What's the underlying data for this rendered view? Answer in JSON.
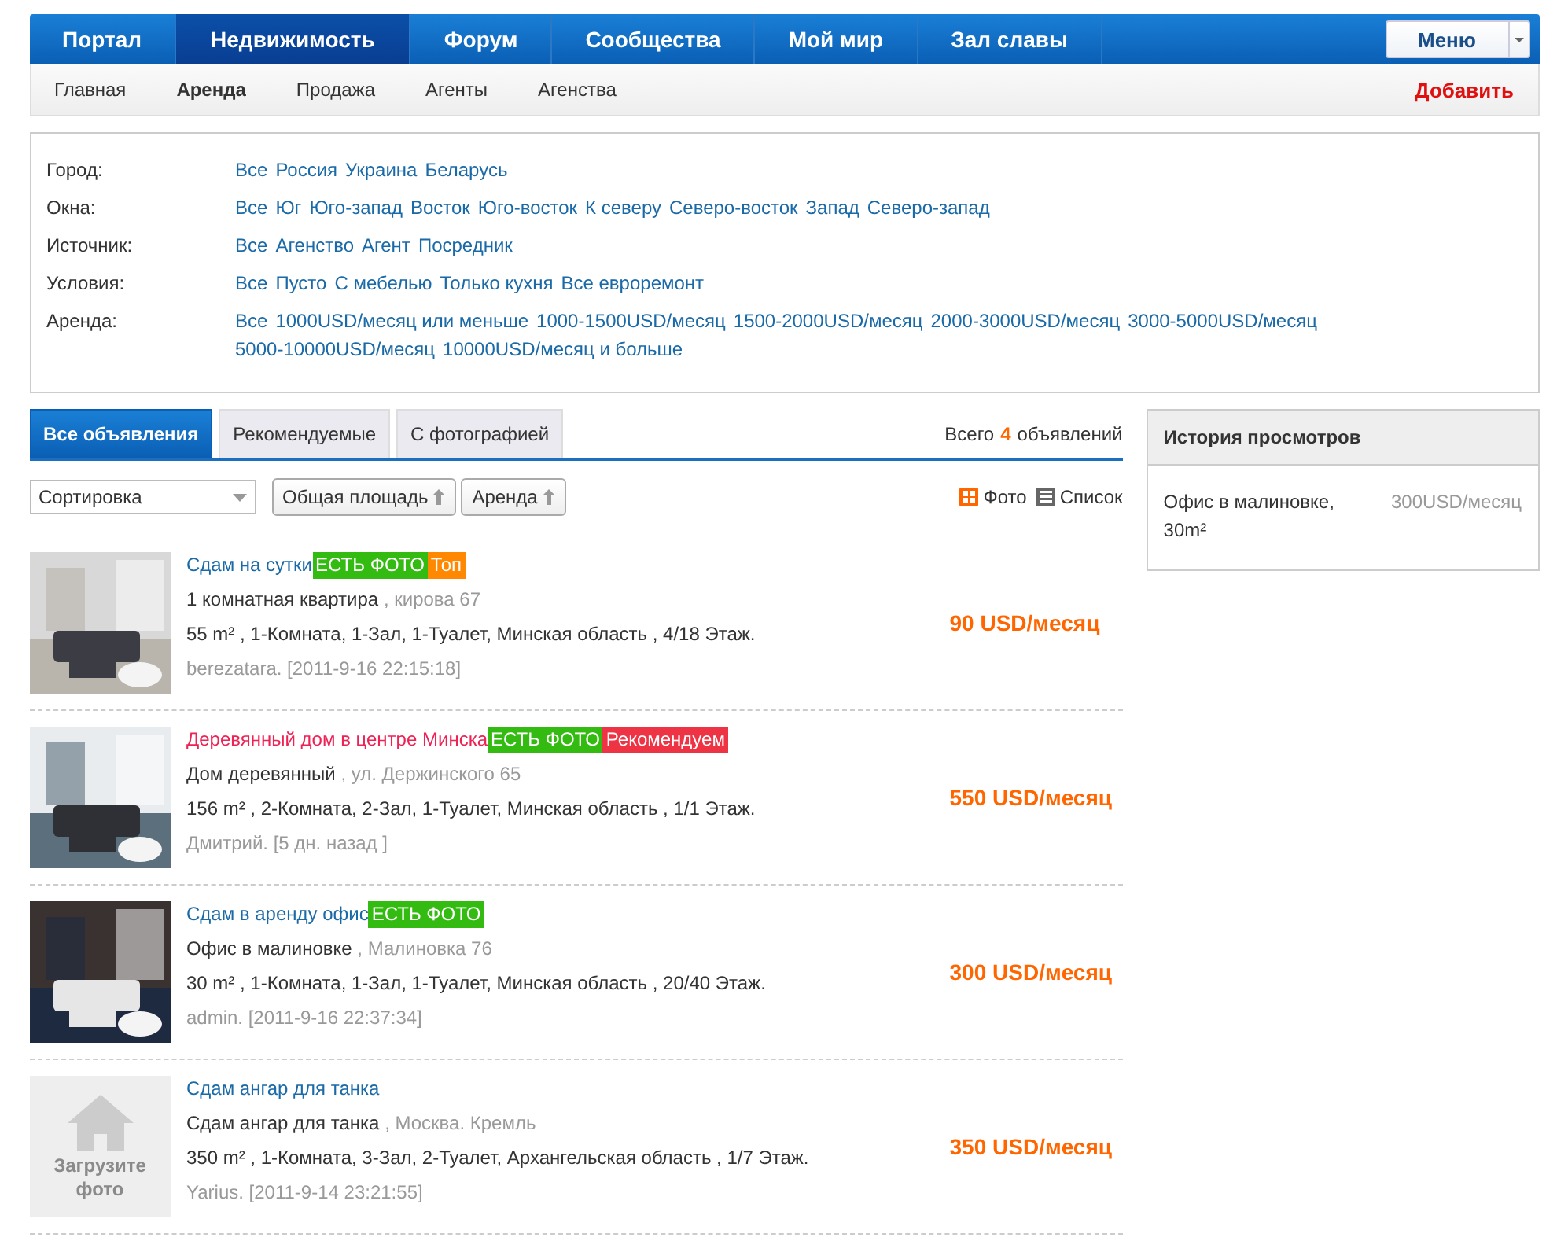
{
  "top_nav": {
    "items": [
      {
        "label": "Портал",
        "selected": false
      },
      {
        "label": "Недвижимость",
        "selected": true
      },
      {
        "label": "Форум",
        "selected": false
      },
      {
        "label": "Сообщества",
        "selected": false
      },
      {
        "label": "Мой мир",
        "selected": false
      },
      {
        "label": "Зал славы",
        "selected": false
      }
    ],
    "menu_button": "Меню"
  },
  "sub_nav": {
    "items": [
      {
        "label": "Главная",
        "selected": false
      },
      {
        "label": "Аренда",
        "selected": true
      },
      {
        "label": "Продажа",
        "selected": false
      },
      {
        "label": "Агенты",
        "selected": false
      },
      {
        "label": "Агенства",
        "selected": false
      }
    ],
    "add_link": "Добавить"
  },
  "filters": [
    {
      "label": "Город:",
      "options": [
        "Все",
        "Россия",
        "Украина",
        "Беларусь"
      ]
    },
    {
      "label": "Окна:",
      "options": [
        "Все",
        "Юг",
        "Юго-запад",
        "Восток",
        "Юго-восток",
        "К северу",
        "Северо-восток",
        "Запад",
        "Северо-запад"
      ]
    },
    {
      "label": "Источник:",
      "options": [
        "Все",
        "Агенство",
        "Агент",
        "Посредник"
      ]
    },
    {
      "label": "Условия:",
      "options": [
        "Все",
        "Пусто",
        "С мебелью",
        "Только кухня",
        "Все евроремонт"
      ]
    },
    {
      "label": "Аренда:",
      "options": [
        "Все",
        "1000USD/месяц или меньше",
        "1000-1500USD/месяц",
        "1500-2000USD/месяц",
        "2000-3000USD/месяц",
        "3000-5000USD/месяц",
        "5000-10000USD/месяц",
        "10000USD/месяц и больше"
      ]
    }
  ],
  "tabs": [
    {
      "label": "Все объявления",
      "selected": true
    },
    {
      "label": "Рекомендуемые",
      "selected": false
    },
    {
      "label": "С фотографией",
      "selected": false
    }
  ],
  "total": {
    "prefix": "Всего",
    "count": "4",
    "suffix": "объявлений"
  },
  "toolbar": {
    "sort_select": "Сортировка",
    "sort_buttons": [
      "Общая площадь",
      "Аренда"
    ],
    "views": [
      {
        "label": "Фото",
        "kind": "grid",
        "selected": true
      },
      {
        "label": "Список",
        "kind": "list",
        "selected": false
      }
    ]
  },
  "listings": [
    {
      "title": "Сдам на сутки",
      "highlighted": false,
      "badges": [
        {
          "label": "ЕСТЬ ФОТО",
          "color": "#33bb11"
        },
        {
          "label": "Топ",
          "color": "#ff8800"
        }
      ],
      "subtitle": "1 комнатная квартира",
      "address": ", кирова 67",
      "details": "55 m² , 1-Комната, 1-Зал, 1-Туалет, Минская область , 4/18 Этаж.",
      "meta": "berezatara. [2011-9-16 22:15:18]",
      "price": "90 USD/месяц",
      "image": {
        "kind": "picture"
      }
    },
    {
      "title": "Деревянный дом в центре Минска",
      "highlighted": true,
      "badges": [
        {
          "label": "ЕСТЬ ФОТО",
          "color": "#33bb11"
        },
        {
          "label": "Рекомендуем",
          "color": "#ee3344"
        }
      ],
      "subtitle": "Дом деревянный",
      "address": ", ул. Держинского 65",
      "details": "156 m² , 2-Комната, 2-Зал, 1-Туалет, Минская область , 1/1 Этаж.",
      "meta": "Дмитрий. [5 дн. назад ]",
      "price": "550 USD/месяц",
      "image": {
        "kind": "picture"
      }
    },
    {
      "title": "Сдам в аренду офис",
      "highlighted": false,
      "badges": [
        {
          "label": "ЕСТЬ ФОТО",
          "color": "#33bb11"
        }
      ],
      "subtitle": "Офис в малиновке",
      "address": ", Малиновка 76",
      "details": "30 m² , 1-Комната, 1-Зал, 1-Туалет, Минская область , 20/40 Этаж.",
      "meta": "admin. [2011-9-16 22:37:34]",
      "price": "300 USD/месяц",
      "image": {
        "kind": "picture"
      }
    },
    {
      "title": "Сдам ангар для танка",
      "highlighted": false,
      "subtitle": "Сдам ангар для танка",
      "address": ", Москва. Кремль",
      "details": "350 m² , 1-Комната, 3-Зал, 2-Туалет, Архангельская область , 1/7 Этаж.",
      "meta": "Yarius. [2011-9-14 23:21:55]",
      "price": "350 USD/месяц",
      "image": {
        "kind": "placeholder",
        "text": "Загрузите фото"
      }
    }
  ],
  "history": {
    "title": "История просмотров",
    "items": [
      {
        "name": "Офис в малиновке, 30m²",
        "price": "300USD/месяц"
      }
    ]
  }
}
